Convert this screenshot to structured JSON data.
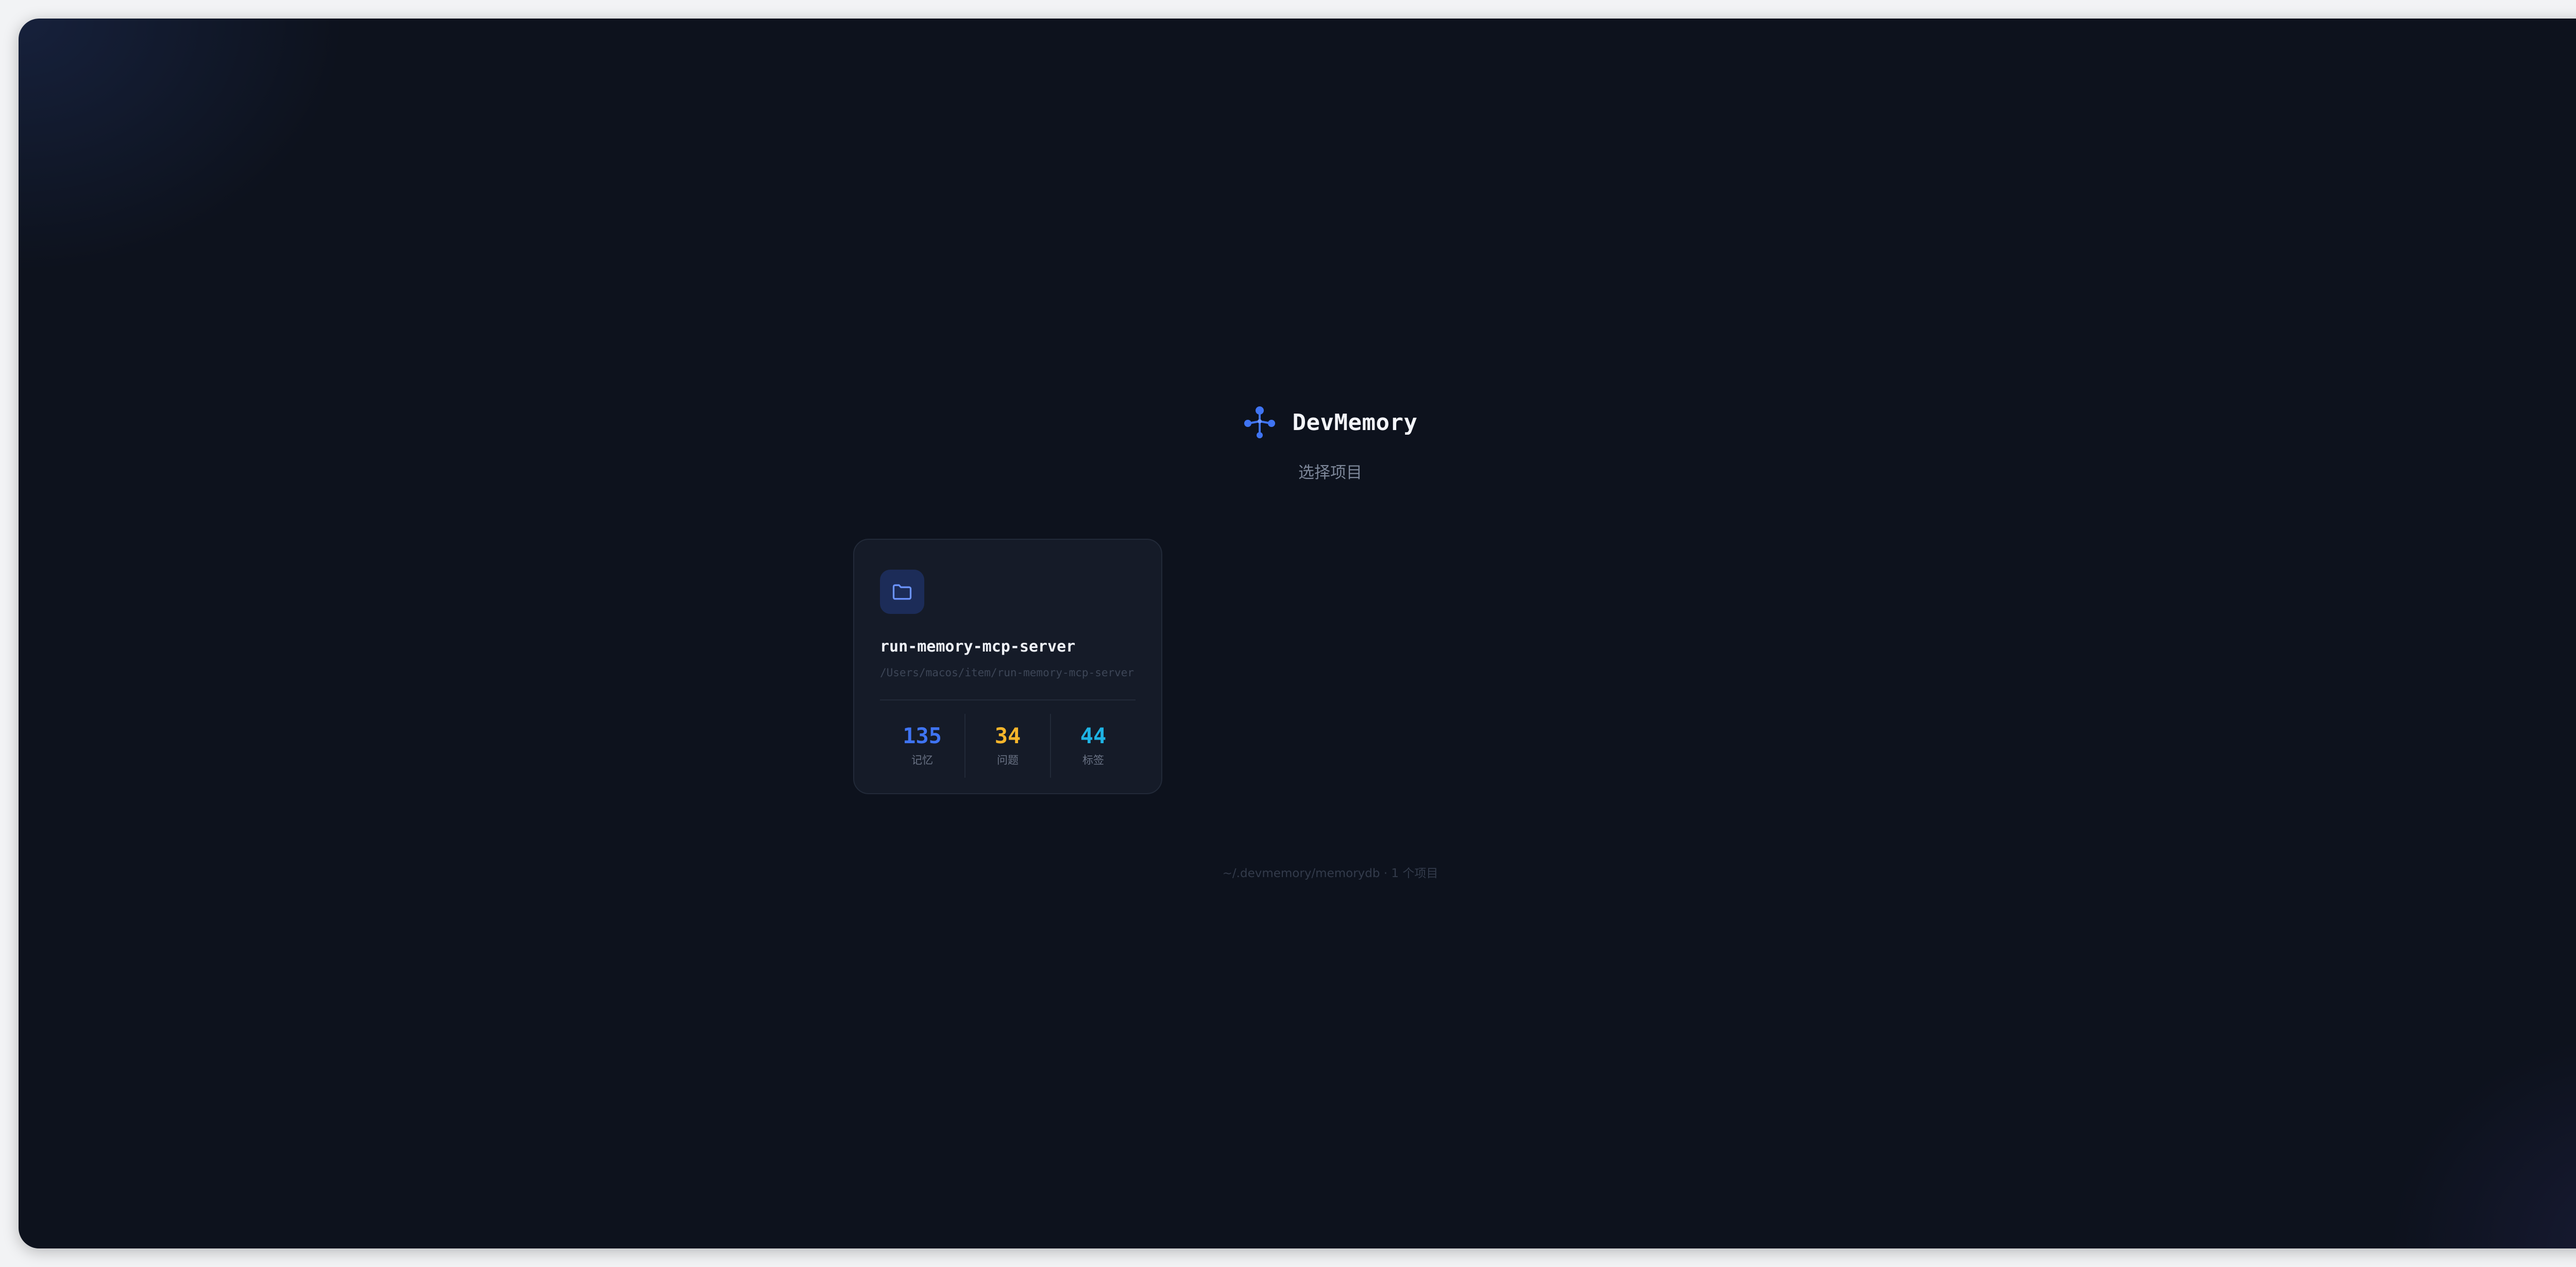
{
  "app": {
    "title": "DevMemory",
    "subtitle": "选择项目",
    "logo_icon": "molecule-nodes-icon"
  },
  "colors": {
    "background": "#0d121d",
    "card": "#151b28",
    "accent_blue": "#3f74f3",
    "accent_yellow": "#f6b52b",
    "accent_cyan": "#1eb3e4"
  },
  "projects": [
    {
      "name": "run-memory-mcp-server",
      "path": "/Users/macos/item/run-memory-mcp-server",
      "icon": "folder-icon",
      "stats": [
        {
          "value": "135",
          "label": "记忆",
          "color": "#3f74f3"
        },
        {
          "value": "34",
          "label": "问题",
          "color": "#f6b52b"
        },
        {
          "value": "44",
          "label": "标签",
          "color": "#1eb3e4"
        }
      ]
    }
  ],
  "footer": {
    "text": "~/.devmemory/memorydb · 1 个项目"
  }
}
